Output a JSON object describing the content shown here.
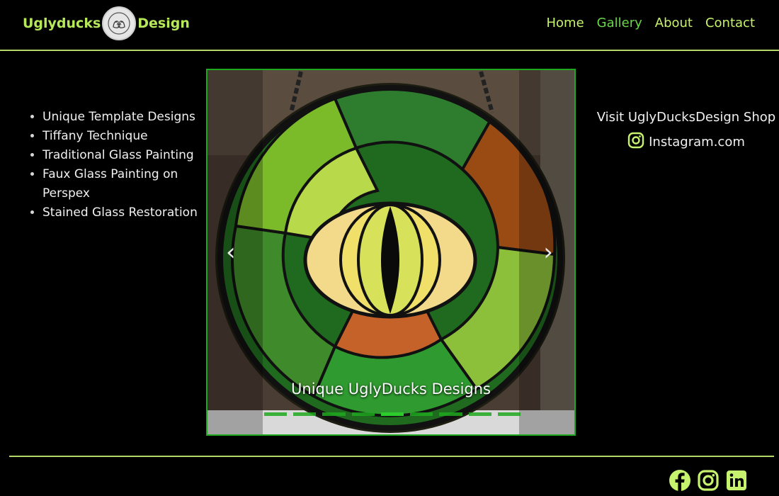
{
  "brand": {
    "left": "Uglyducks",
    "right": "Design",
    "logo_icon": "ducks-logo-icon"
  },
  "nav": {
    "items": [
      "Home",
      "Gallery",
      "About",
      "Contact"
    ],
    "active": "Gallery"
  },
  "features": [
    "Unique Template Designs",
    "Tiffany Technique",
    "Traditional Glass Painting",
    "Faux Glass Painting on Perspex",
    "Stained Glass Restoration"
  ],
  "carousel": {
    "caption": "Unique UglyDucks Designs",
    "indicator_count": 9,
    "active_index": 4,
    "prev_icon": "chevron-left-icon",
    "next_icon": "chevron-right-icon"
  },
  "shop": {
    "title": "Visit UglyDucksDesign Shop",
    "link_text": "Instagram.com",
    "icon": "instagram-icon"
  },
  "footer": {
    "socials": [
      "facebook-icon",
      "instagram-icon",
      "linkedin-icon"
    ]
  },
  "colors": {
    "accent": "#b6e85a",
    "active_nav": "#6bd64a",
    "carousel_border": "#1fa81f",
    "background": "#000000"
  }
}
